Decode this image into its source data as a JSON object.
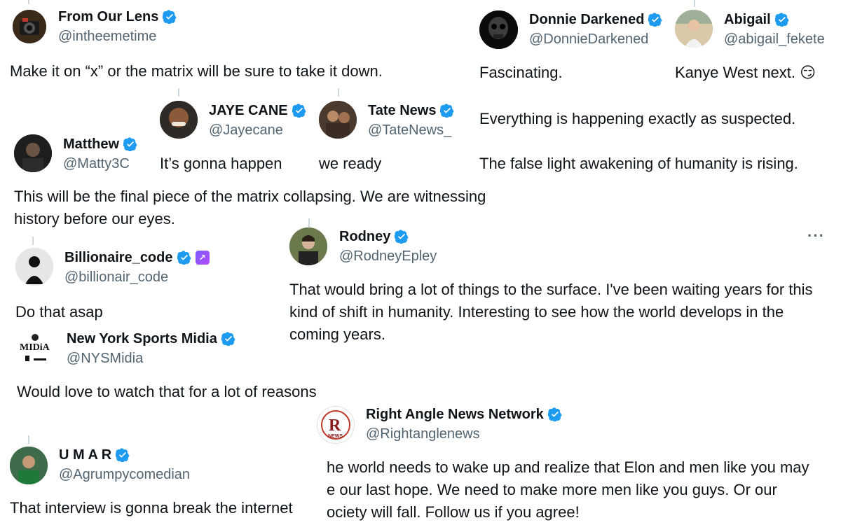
{
  "posts": {
    "fromourlens": {
      "name": "From Our Lens",
      "handle": "@intheemetime",
      "text": "Make it on “x” or the matrix will be sure to take it down."
    },
    "donnie": {
      "name": "Donnie Darkened",
      "handle": "@DonnieDarkened",
      "text": "Fascinating."
    },
    "abigail": {
      "name": "Abigail",
      "handle": "@abigail_fekete",
      "text": "Kanye West next.",
      "emoji": "😏"
    },
    "jaye": {
      "name": "JAYE CANE",
      "handle": "@Jayecane",
      "text": "It’s gonna happen"
    },
    "tate": {
      "name": "Tate News",
      "handle": "@TateNews_",
      "text": "we ready"
    },
    "matthew": {
      "name": "Matthew",
      "handle": "@Matty3C",
      "text": "This will be the final piece of the matrix collapsing. We are witnessing history before our eyes."
    },
    "misc": {
      "line1": "Everything is happening exactly as suspected.",
      "line2": "The false light awakening of humanity is rising."
    },
    "billionaire": {
      "name": "Billionaire_code",
      "handle": "@billionair_code",
      "text": "Do that asap"
    },
    "rodney": {
      "name": "Rodney",
      "handle": "@RodneyEpley",
      "text": "That would bring a lot of things to the surface. I've been waiting years for this kind of shift in humanity. Interesting to see how the world develops in the coming years.",
      "more": "···"
    },
    "nysm": {
      "name": "New York Sports Midia",
      "handle": "@NYSMidia",
      "text": "Would love to watch that for a lot of reasons",
      "logo_text": "MIDiA"
    },
    "rightangle": {
      "name": "Right Angle News Network",
      "handle": "@Rightanglenews",
      "text": "he world needs to wake up and realize that Elon and men like you may\ne our last hope. We need to make more men like you guys. Or our\nociety will fall. Follow us if you agree!",
      "logo_letter": "R",
      "logo_sub": "NEWS"
    },
    "umar": {
      "name": "U M A R",
      "handle": "@Agrumpycomedian",
      "text": "That interview is gonna break the internet"
    }
  },
  "colors": {
    "verified": "#1d9bf0",
    "handle": "#536471",
    "text": "#0f1419"
  }
}
